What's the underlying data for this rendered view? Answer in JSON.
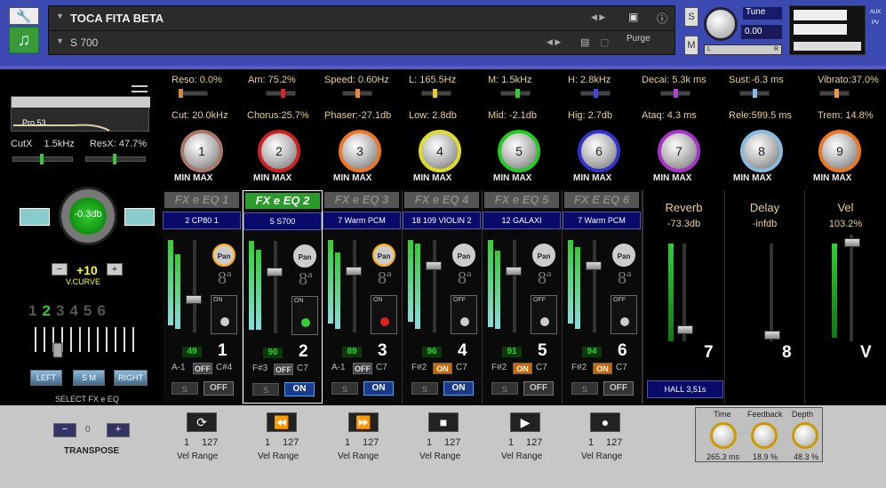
{
  "header": {
    "title": "TOCA FITA BETA",
    "subtitle": "S 700",
    "purge_label": "Purge",
    "s_label": "S",
    "m_label": "M",
    "tune_label": "Tune",
    "tune_value": "0.00",
    "lr_left": "L",
    "lr_right": "R",
    "aux_label": "AUX",
    "pv_label": "PV",
    "icons": [
      "wrench-icon",
      "music-note-icon",
      "camera-icon",
      "info-icon",
      "save-icon",
      "trash-icon"
    ]
  },
  "left": {
    "filter_name": "Pro 53",
    "cutx_label": "CutX",
    "cutx_value": "1.5kHz",
    "resx_label": "ResX:",
    "resx_value": "47.7%",
    "volume": "-0.3db",
    "vcurve_value": "+10",
    "vcurve_label": "V.CURVE",
    "fx_digits": [
      "1",
      "2",
      "3",
      "4",
      "5",
      "6"
    ],
    "selected_digit": "2",
    "btn_left": "LEFT",
    "btn_sm": "S M",
    "btn_right": "RIGHT",
    "select_label": "SELECT  FX e EQ"
  },
  "params": {
    "top": [
      "Reso: 0.0%",
      "Am: 75.2%",
      "Speed: 0.60Hz",
      "L: 165.5Hz",
      "M:  1.5kHz",
      "H:  2.8kHz",
      "Decai: 5.3k ms",
      "Sust:-6.3 ms",
      "Vibrato:37.0%"
    ],
    "bottom": [
      "Cut: 20.0kHz",
      "Chorus:25.7%",
      "Phaser:-27.1db",
      "Low:  2.8db",
      "Mid: -2.1db",
      "Hig:  2.7db",
      "Ataq:  4.3 ms",
      "Rele:599.5 ms",
      "Trem: 14.8%"
    ],
    "knobs": [
      "1",
      "2",
      "3",
      "4",
      "5",
      "6",
      "7",
      "8",
      "9"
    ],
    "min": "MIN",
    "max": "MAX"
  },
  "channels": [
    {
      "head": "FX e EQ 1",
      "preset": "2 CP80 1",
      "vel": "49",
      "num": "1",
      "lo": "A-1",
      "hi": "C#4",
      "state": "OFF",
      "s": "S",
      "onoff": "OFF",
      "sw": "ON"
    },
    {
      "head": "FX e EQ 2",
      "preset": "5 S700",
      "vel": "90",
      "num": "2",
      "lo": "F#3",
      "hi": "C7",
      "state": "OFF",
      "s": "S",
      "onoff": "ON",
      "sw": "ON"
    },
    {
      "head": "FX e EQ 3",
      "preset": "7 Warm PCM",
      "vel": "89",
      "num": "3",
      "lo": "A-1",
      "hi": "C7",
      "state": "OFF",
      "s": "S",
      "onoff": "ON",
      "sw": "ON"
    },
    {
      "head": "FX e EQ 4",
      "preset": "18 109 VIOLIN 2",
      "vel": "96",
      "num": "4",
      "lo": "F#2",
      "hi": "C7",
      "state": "ON",
      "s": "S",
      "onoff": "ON",
      "sw": "OFF"
    },
    {
      "head": "FX e EQ 5",
      "preset": "12 GALAXI",
      "vel": "91",
      "num": "5",
      "lo": "F#2",
      "hi": "C7",
      "state": "ON",
      "s": "S",
      "onoff": "OFF",
      "sw": "OFF"
    },
    {
      "head": "FX E EQ 6",
      "preset": "7 Warm PCM",
      "vel": "94",
      "num": "6",
      "lo": "F#2",
      "hi": "C7",
      "state": "ON",
      "s": "S",
      "onoff": "OFF",
      "sw": "OFF"
    }
  ],
  "pan_label": "Pan",
  "octave": "8ª",
  "fx": [
    {
      "title": "Reverb",
      "value": "-73.3db",
      "num": "7"
    },
    {
      "title": "Delay",
      "value": "-infdb",
      "num": "8"
    },
    {
      "title": "Vel",
      "value": "103.2%",
      "num": "V"
    }
  ],
  "hall": "HALL 3,51s",
  "bottom": {
    "transpose": "TRANSPOSE",
    "transpose_value": "0",
    "vel_ranges": [
      {
        "lo": "1",
        "hi": "127",
        "label": "Vel Range"
      },
      {
        "lo": "1",
        "hi": "127",
        "label": "Vel Range"
      },
      {
        "lo": "1",
        "hi": "127",
        "label": "Vel Range"
      },
      {
        "lo": "1",
        "hi": "127",
        "label": "Vel Range"
      },
      {
        "lo": "1",
        "hi": "127",
        "label": "Vel Range"
      },
      {
        "lo": "1",
        "hi": "127",
        "label": "Vel Range"
      }
    ],
    "delay": {
      "time_label": "Time",
      "time_value": "265.3 ms",
      "feedback_label": "Feedback",
      "feedback_value": "18.9 %",
      "depth_label": "Depth",
      "depth_value": "48.3 %"
    }
  },
  "colors": {
    "header": "#3a4ab0",
    "accent_green": "#3c3",
    "panel_gray": "#c7c7c7",
    "label": "#e8d090"
  }
}
